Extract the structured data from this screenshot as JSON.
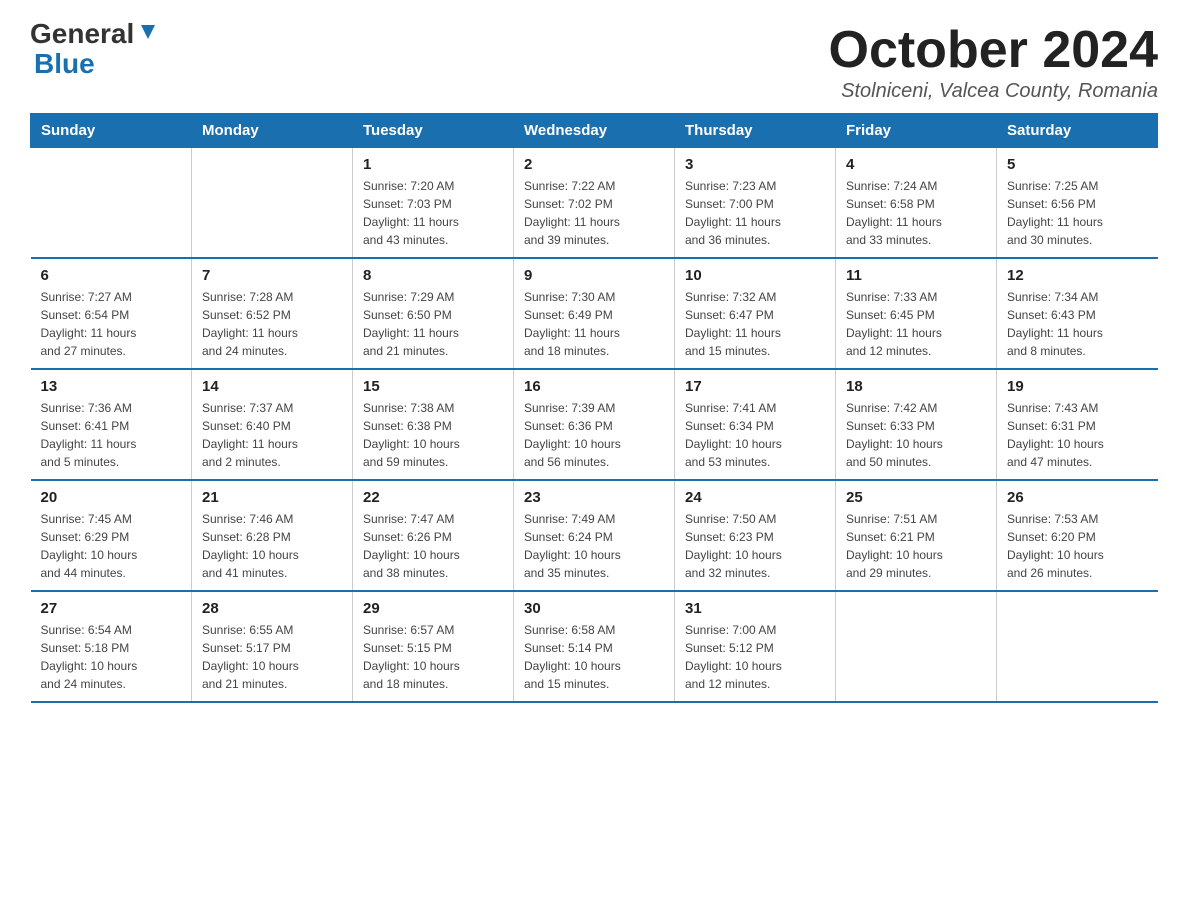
{
  "header": {
    "logo_line1": "General",
    "logo_line2": "Blue",
    "month_title": "October 2024",
    "location": "Stolniceni, Valcea County, Romania"
  },
  "days_of_week": [
    "Sunday",
    "Monday",
    "Tuesday",
    "Wednesday",
    "Thursday",
    "Friday",
    "Saturday"
  ],
  "weeks": [
    [
      {
        "day": "",
        "info": ""
      },
      {
        "day": "",
        "info": ""
      },
      {
        "day": "1",
        "info": "Sunrise: 7:20 AM\nSunset: 7:03 PM\nDaylight: 11 hours\nand 43 minutes."
      },
      {
        "day": "2",
        "info": "Sunrise: 7:22 AM\nSunset: 7:02 PM\nDaylight: 11 hours\nand 39 minutes."
      },
      {
        "day": "3",
        "info": "Sunrise: 7:23 AM\nSunset: 7:00 PM\nDaylight: 11 hours\nand 36 minutes."
      },
      {
        "day": "4",
        "info": "Sunrise: 7:24 AM\nSunset: 6:58 PM\nDaylight: 11 hours\nand 33 minutes."
      },
      {
        "day": "5",
        "info": "Sunrise: 7:25 AM\nSunset: 6:56 PM\nDaylight: 11 hours\nand 30 minutes."
      }
    ],
    [
      {
        "day": "6",
        "info": "Sunrise: 7:27 AM\nSunset: 6:54 PM\nDaylight: 11 hours\nand 27 minutes."
      },
      {
        "day": "7",
        "info": "Sunrise: 7:28 AM\nSunset: 6:52 PM\nDaylight: 11 hours\nand 24 minutes."
      },
      {
        "day": "8",
        "info": "Sunrise: 7:29 AM\nSunset: 6:50 PM\nDaylight: 11 hours\nand 21 minutes."
      },
      {
        "day": "9",
        "info": "Sunrise: 7:30 AM\nSunset: 6:49 PM\nDaylight: 11 hours\nand 18 minutes."
      },
      {
        "day": "10",
        "info": "Sunrise: 7:32 AM\nSunset: 6:47 PM\nDaylight: 11 hours\nand 15 minutes."
      },
      {
        "day": "11",
        "info": "Sunrise: 7:33 AM\nSunset: 6:45 PM\nDaylight: 11 hours\nand 12 minutes."
      },
      {
        "day": "12",
        "info": "Sunrise: 7:34 AM\nSunset: 6:43 PM\nDaylight: 11 hours\nand 8 minutes."
      }
    ],
    [
      {
        "day": "13",
        "info": "Sunrise: 7:36 AM\nSunset: 6:41 PM\nDaylight: 11 hours\nand 5 minutes."
      },
      {
        "day": "14",
        "info": "Sunrise: 7:37 AM\nSunset: 6:40 PM\nDaylight: 11 hours\nand 2 minutes."
      },
      {
        "day": "15",
        "info": "Sunrise: 7:38 AM\nSunset: 6:38 PM\nDaylight: 10 hours\nand 59 minutes."
      },
      {
        "day": "16",
        "info": "Sunrise: 7:39 AM\nSunset: 6:36 PM\nDaylight: 10 hours\nand 56 minutes."
      },
      {
        "day": "17",
        "info": "Sunrise: 7:41 AM\nSunset: 6:34 PM\nDaylight: 10 hours\nand 53 minutes."
      },
      {
        "day": "18",
        "info": "Sunrise: 7:42 AM\nSunset: 6:33 PM\nDaylight: 10 hours\nand 50 minutes."
      },
      {
        "day": "19",
        "info": "Sunrise: 7:43 AM\nSunset: 6:31 PM\nDaylight: 10 hours\nand 47 minutes."
      }
    ],
    [
      {
        "day": "20",
        "info": "Sunrise: 7:45 AM\nSunset: 6:29 PM\nDaylight: 10 hours\nand 44 minutes."
      },
      {
        "day": "21",
        "info": "Sunrise: 7:46 AM\nSunset: 6:28 PM\nDaylight: 10 hours\nand 41 minutes."
      },
      {
        "day": "22",
        "info": "Sunrise: 7:47 AM\nSunset: 6:26 PM\nDaylight: 10 hours\nand 38 minutes."
      },
      {
        "day": "23",
        "info": "Sunrise: 7:49 AM\nSunset: 6:24 PM\nDaylight: 10 hours\nand 35 minutes."
      },
      {
        "day": "24",
        "info": "Sunrise: 7:50 AM\nSunset: 6:23 PM\nDaylight: 10 hours\nand 32 minutes."
      },
      {
        "day": "25",
        "info": "Sunrise: 7:51 AM\nSunset: 6:21 PM\nDaylight: 10 hours\nand 29 minutes."
      },
      {
        "day": "26",
        "info": "Sunrise: 7:53 AM\nSunset: 6:20 PM\nDaylight: 10 hours\nand 26 minutes."
      }
    ],
    [
      {
        "day": "27",
        "info": "Sunrise: 6:54 AM\nSunset: 5:18 PM\nDaylight: 10 hours\nand 24 minutes."
      },
      {
        "day": "28",
        "info": "Sunrise: 6:55 AM\nSunset: 5:17 PM\nDaylight: 10 hours\nand 21 minutes."
      },
      {
        "day": "29",
        "info": "Sunrise: 6:57 AM\nSunset: 5:15 PM\nDaylight: 10 hours\nand 18 minutes."
      },
      {
        "day": "30",
        "info": "Sunrise: 6:58 AM\nSunset: 5:14 PM\nDaylight: 10 hours\nand 15 minutes."
      },
      {
        "day": "31",
        "info": "Sunrise: 7:00 AM\nSunset: 5:12 PM\nDaylight: 10 hours\nand 12 minutes."
      },
      {
        "day": "",
        "info": ""
      },
      {
        "day": "",
        "info": ""
      }
    ]
  ]
}
